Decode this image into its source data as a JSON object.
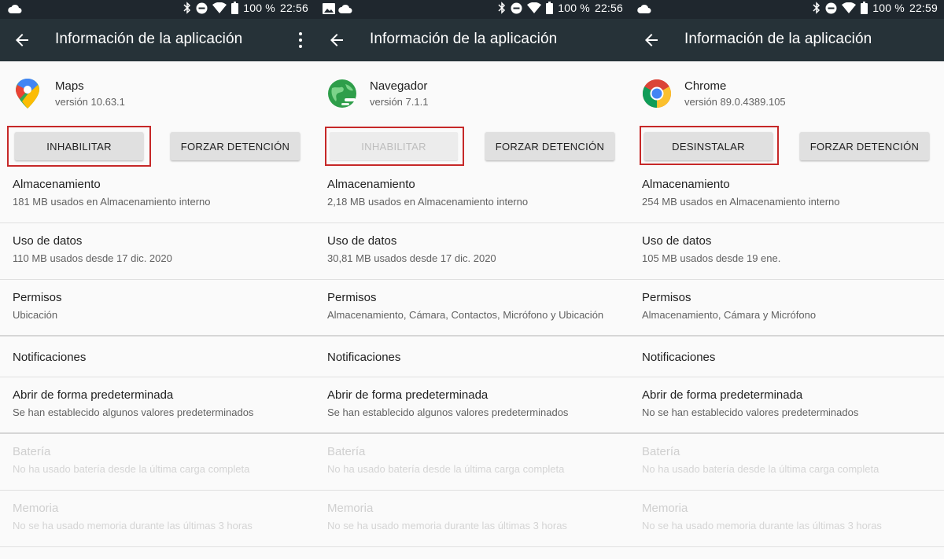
{
  "panels": [
    {
      "status": {
        "battery": "100 %",
        "time": "22:56",
        "left_icons": [
          "cloud-icon"
        ]
      },
      "toolbar": {
        "title": "Información de la aplicación",
        "has_menu": true
      },
      "app": {
        "name": "Maps",
        "version": "versión 10.63.1",
        "icon": "maps-pin-icon"
      },
      "buttons": {
        "left": "INHABILITAR",
        "left_disabled": false,
        "right": "FORZAR DETENCIÓN"
      },
      "items": {
        "storage": {
          "title": "Almacenamiento",
          "subtitle": "181 MB usados en Almacenamiento interno"
        },
        "data": {
          "title": "Uso de datos",
          "subtitle": "110 MB usados desde 17 dic. 2020"
        },
        "perms": {
          "title": "Permisos",
          "subtitle": "Ubicación"
        },
        "notif": {
          "title": "Notificaciones"
        },
        "default": {
          "title": "Abrir de forma predeterminada",
          "subtitle": "Se han establecido algunos valores predeterminados"
        },
        "battery": {
          "title": "Batería",
          "subtitle": "No ha usado batería desde la última carga completa"
        },
        "memory": {
          "title": "Memoria",
          "subtitle": "No se ha usado memoria durante las últimas 3 horas"
        }
      }
    },
    {
      "status": {
        "battery": "100 %",
        "time": "22:56",
        "left_icons": [
          "image-icon",
          "cloud-icon"
        ]
      },
      "toolbar": {
        "title": "Información de la aplicación",
        "has_menu": false
      },
      "app": {
        "name": "Navegador",
        "version": "versión 7.1.1",
        "icon": "browser-globe-icon"
      },
      "buttons": {
        "left": "INHABILITAR",
        "left_disabled": true,
        "right": "FORZAR DETENCIÓN"
      },
      "items": {
        "storage": {
          "title": "Almacenamiento",
          "subtitle": "2,18 MB usados en Almacenamiento interno"
        },
        "data": {
          "title": "Uso de datos",
          "subtitle": "30,81 MB usados desde 17 dic. 2020"
        },
        "perms": {
          "title": "Permisos",
          "subtitle": "Almacenamiento, Cámara, Contactos, Micrófono y Ubicación"
        },
        "notif": {
          "title": "Notificaciones"
        },
        "default": {
          "title": "Abrir de forma predeterminada",
          "subtitle": "Se han establecido algunos valores predeterminados"
        },
        "battery": {
          "title": "Batería",
          "subtitle": "No ha usado batería desde la última carga completa"
        },
        "memory": {
          "title": "Memoria",
          "subtitle": "No se ha usado memoria durante las últimas 3 horas"
        }
      }
    },
    {
      "status": {
        "battery": "100 %",
        "time": "22:59",
        "left_icons": [
          "cloud-icon"
        ]
      },
      "toolbar": {
        "title": "Información de la aplicación",
        "has_menu": false
      },
      "app": {
        "name": "Chrome",
        "version": "versión 89.0.4389.105",
        "icon": "chrome-icon"
      },
      "buttons": {
        "left": "DESINSTALAR",
        "left_disabled": false,
        "right": "FORZAR DETENCIÓN"
      },
      "items": {
        "storage": {
          "title": "Almacenamiento",
          "subtitle": "254 MB usados en Almacenamiento interno"
        },
        "data": {
          "title": "Uso de datos",
          "subtitle": "105 MB usados desde 19 ene."
        },
        "perms": {
          "title": "Permisos",
          "subtitle": "Almacenamiento, Cámara y Micrófono"
        },
        "notif": {
          "title": "Notificaciones"
        },
        "default": {
          "title": "Abrir de forma predeterminada",
          "subtitle": "No se han establecido valores predeterminados"
        },
        "battery": {
          "title": "Batería",
          "subtitle": "No ha usado batería desde la última carga completa"
        },
        "memory": {
          "title": "Memoria",
          "subtitle": "No se ha usado memoria durante las últimas 3 horas"
        }
      }
    }
  ],
  "colors": {
    "toolbar": "#263238",
    "statusbar": "#1f272e",
    "highlight": "#c62828",
    "button": "#e0e0e0"
  }
}
